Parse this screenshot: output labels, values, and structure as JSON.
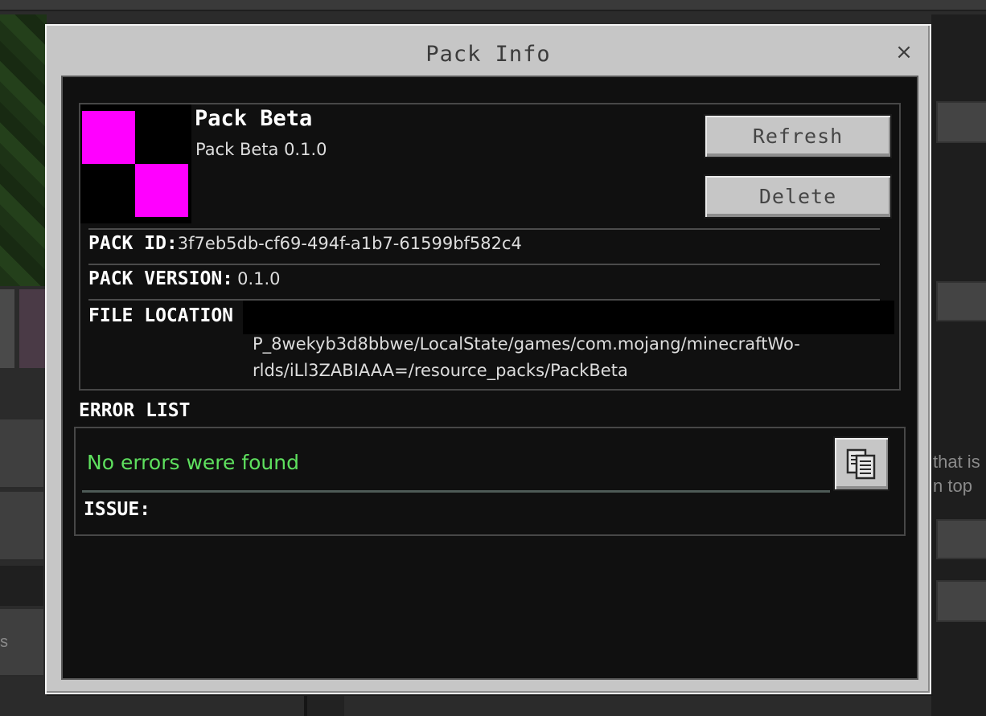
{
  "background": {
    "right_text_line1": "that is",
    "right_text_line2": "n top",
    "left_text": "s"
  },
  "dialog": {
    "title": "Pack Info",
    "close_glyph": "×"
  },
  "pack": {
    "name": "Pack Beta",
    "subtitle": "Pack Beta 0.1.0",
    "icon": "pack-icon-magenta-checker",
    "icon_colors": {
      "fill": "#ff00ff",
      "background": "#000000"
    },
    "refresh_label": "Refresh",
    "delete_label": "Delete",
    "id_label": "PACK ID:",
    "id_value": "3f7eb5db-cf69-494f-a1b7-61599bf582c4",
    "version_label": "PACK VERSION:",
    "version_value": "0.1.0",
    "location_label": "FILE LOCATION",
    "location_line1": "P_8wekyb3d8bbwe/LocalState/games/com.mojang/minecraftWo-",
    "location_line2": "rlds/iLl3ZABIAAA=/resource_packs/PackBeta"
  },
  "errors": {
    "heading": "ERROR LIST",
    "message": "No errors were found",
    "issue_label": "ISSUE:",
    "copy_icon": "clipboard-copy-icon"
  },
  "colors": {
    "panel": "#c6c6c6",
    "content_bg": "#101010",
    "success_text": "#5ee05e"
  }
}
